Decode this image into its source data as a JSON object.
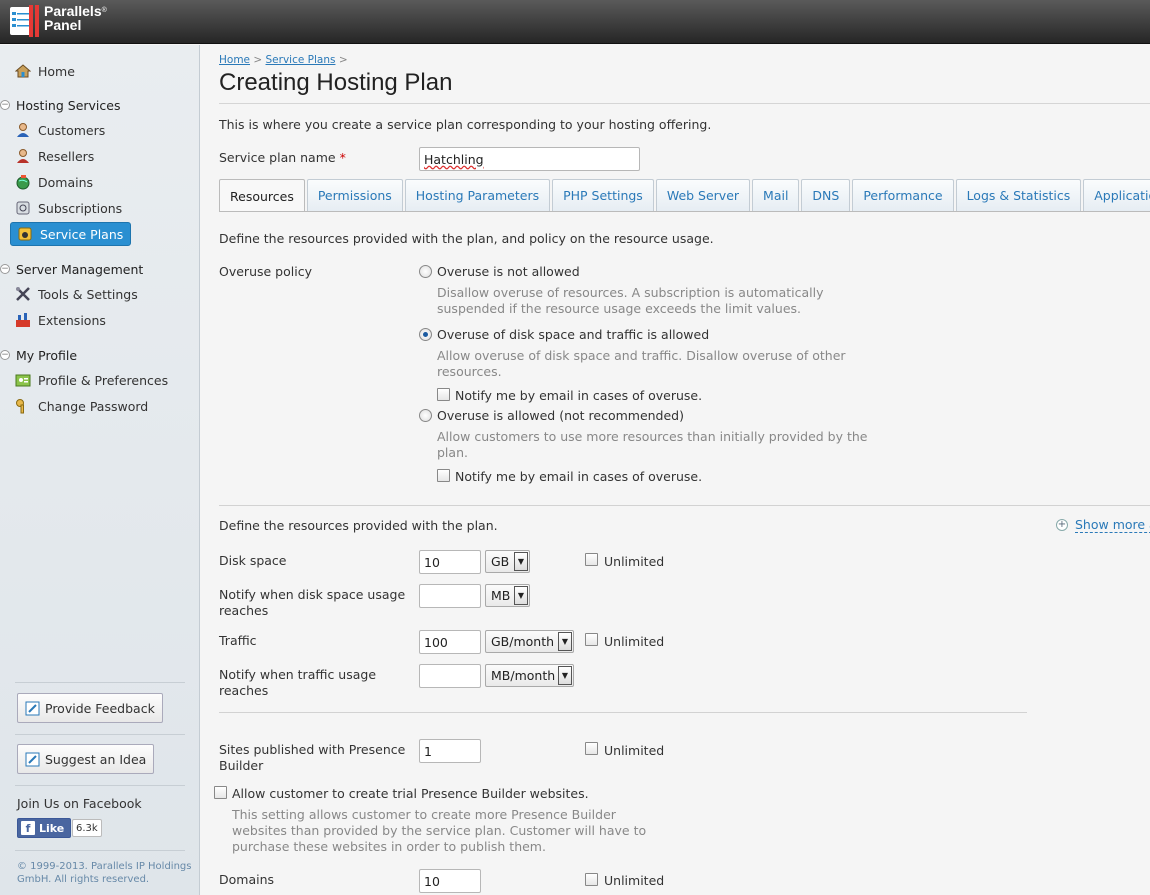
{
  "brand": {
    "line1": "Parallels",
    "line2": "Panel",
    "reg": "®"
  },
  "sidebar": {
    "home": "Home",
    "sections": [
      {
        "title": "Hosting Services",
        "items": [
          "Customers",
          "Resellers",
          "Domains",
          "Subscriptions",
          "Service Plans"
        ]
      },
      {
        "title": "Server Management",
        "items": [
          "Tools & Settings",
          "Extensions"
        ]
      },
      {
        "title": "My Profile",
        "items": [
          "Profile & Preferences",
          "Change Password"
        ]
      }
    ],
    "active_item": "Service Plans",
    "feedback_button": "Provide Feedback",
    "idea_button": "Suggest an Idea",
    "facebook_title": "Join Us on Facebook",
    "facebook_like": "Like",
    "facebook_count": "6.3k",
    "copyright": "© 1999-2013. Parallels IP Holdings GmbH. All rights reserved."
  },
  "breadcrumb": {
    "home": "Home",
    "sep": ">",
    "service_plans": "Service Plans"
  },
  "page_title": "Creating Hosting Plan",
  "intro": "This is where you create a service plan corresponding to your hosting offering.",
  "plan_name": {
    "label": "Service plan name",
    "required": "*",
    "value": "Hatchling"
  },
  "tabs": [
    "Resources",
    "Permissions",
    "Hosting Parameters",
    "PHP Settings",
    "Web Server",
    "Mail",
    "DNS",
    "Performance",
    "Logs & Statistics",
    "Applications"
  ],
  "active_tab": "Resources",
  "overuse": {
    "intro": "Define the resources provided with the plan, and policy on the resource usage.",
    "label": "Overuse policy",
    "options": [
      {
        "label": "Overuse is not allowed",
        "hint": [
          "Disallow overuse of resources. A subscription is automatically",
          "suspended if the resource usage exceeds the limit values."
        ],
        "selected": false
      },
      {
        "label": "Overuse of disk space and traffic is allowed",
        "hint": [
          "Allow overuse of disk space and traffic. Disallow overuse of other",
          "resources."
        ],
        "selected": true,
        "notify": "Notify me by email in cases of overuse."
      },
      {
        "label": "Overuse is allowed (not recommended)",
        "hint": [
          "Allow customers to use more resources than initially provided by the",
          "plan."
        ],
        "selected": false,
        "notify": "Notify me by email in cases of overuse."
      }
    ]
  },
  "resources": {
    "intro": "Define the resources provided with the plan.",
    "show_more": "Show more a",
    "unlimited": "Unlimited",
    "disk_space": {
      "label": "Disk space",
      "value": "10",
      "unit": "GB"
    },
    "disk_notify": {
      "label": [
        "Notify when disk space usage",
        "reaches"
      ],
      "value": "",
      "unit": "MB"
    },
    "traffic": {
      "label": "Traffic",
      "value": "100",
      "unit": "GB/month"
    },
    "traffic_notify": {
      "label": [
        "Notify when traffic usage",
        "reaches"
      ],
      "value": "",
      "unit": "MB/month"
    },
    "presence": {
      "label": [
        "Sites published with Presence",
        "Builder"
      ],
      "value": "1"
    },
    "trial": {
      "label": "Allow customer to create trial Presence Builder websites.",
      "hint": [
        "This setting allows customer to create more Presence Builder",
        "websites than provided by the service plan. Customer will have to",
        "purchase these websites in order to publish them."
      ]
    },
    "domains": {
      "label": "Domains",
      "value": "10"
    }
  }
}
